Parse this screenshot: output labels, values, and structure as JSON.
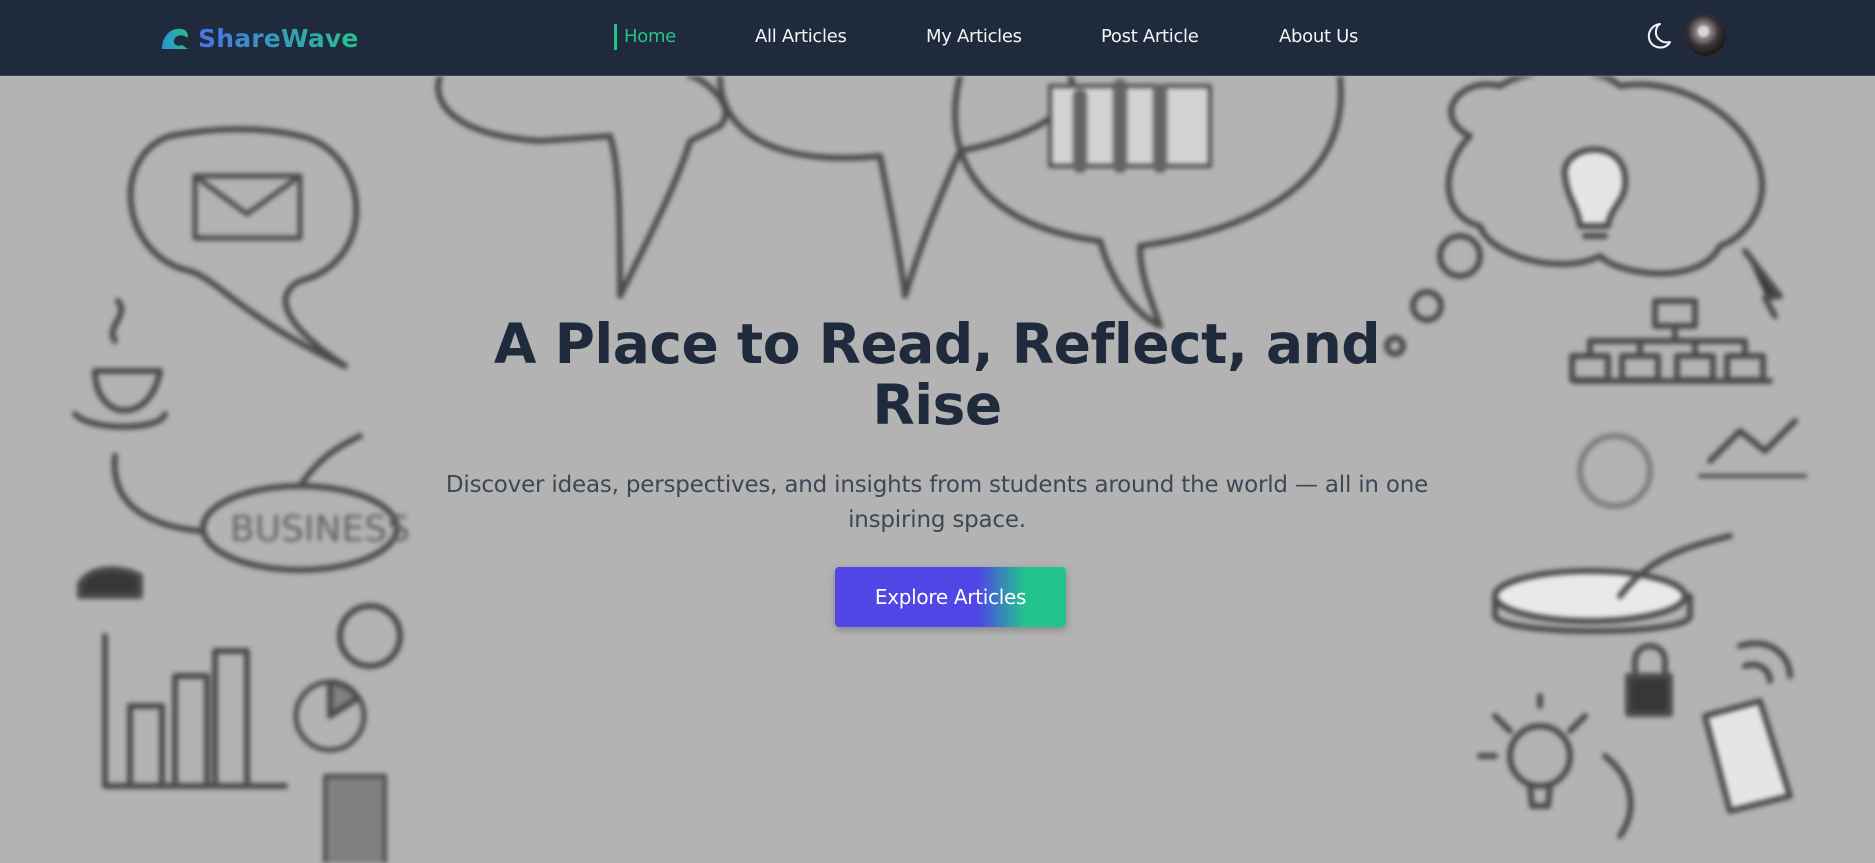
{
  "brand": {
    "name": "ShareWave",
    "icon": "wave-icon",
    "gradient": [
      "#4a73e8",
      "#22c38e"
    ]
  },
  "nav": {
    "items": [
      {
        "label": "Home",
        "active": true
      },
      {
        "label": "All Articles",
        "active": false
      },
      {
        "label": "My Articles",
        "active": false
      },
      {
        "label": "Post Article",
        "active": false
      },
      {
        "label": "About Us",
        "active": false
      }
    ],
    "theme_toggle_icon": "moon-icon",
    "avatar_icon": "user-avatar"
  },
  "hero": {
    "title": "A Place to Read, Reflect, and Rise",
    "subtitle": "Discover ideas, perspectives, and insights from students around the world — all in one inspiring space.",
    "cta_label": "Explore Articles"
  },
  "colors": {
    "navbar_bg": "#1f2a3c",
    "accent_green": "#22c38e",
    "accent_indigo": "#4f46e5",
    "hero_bg": "#b3b3b3",
    "title_text": "#1f2a3c"
  }
}
